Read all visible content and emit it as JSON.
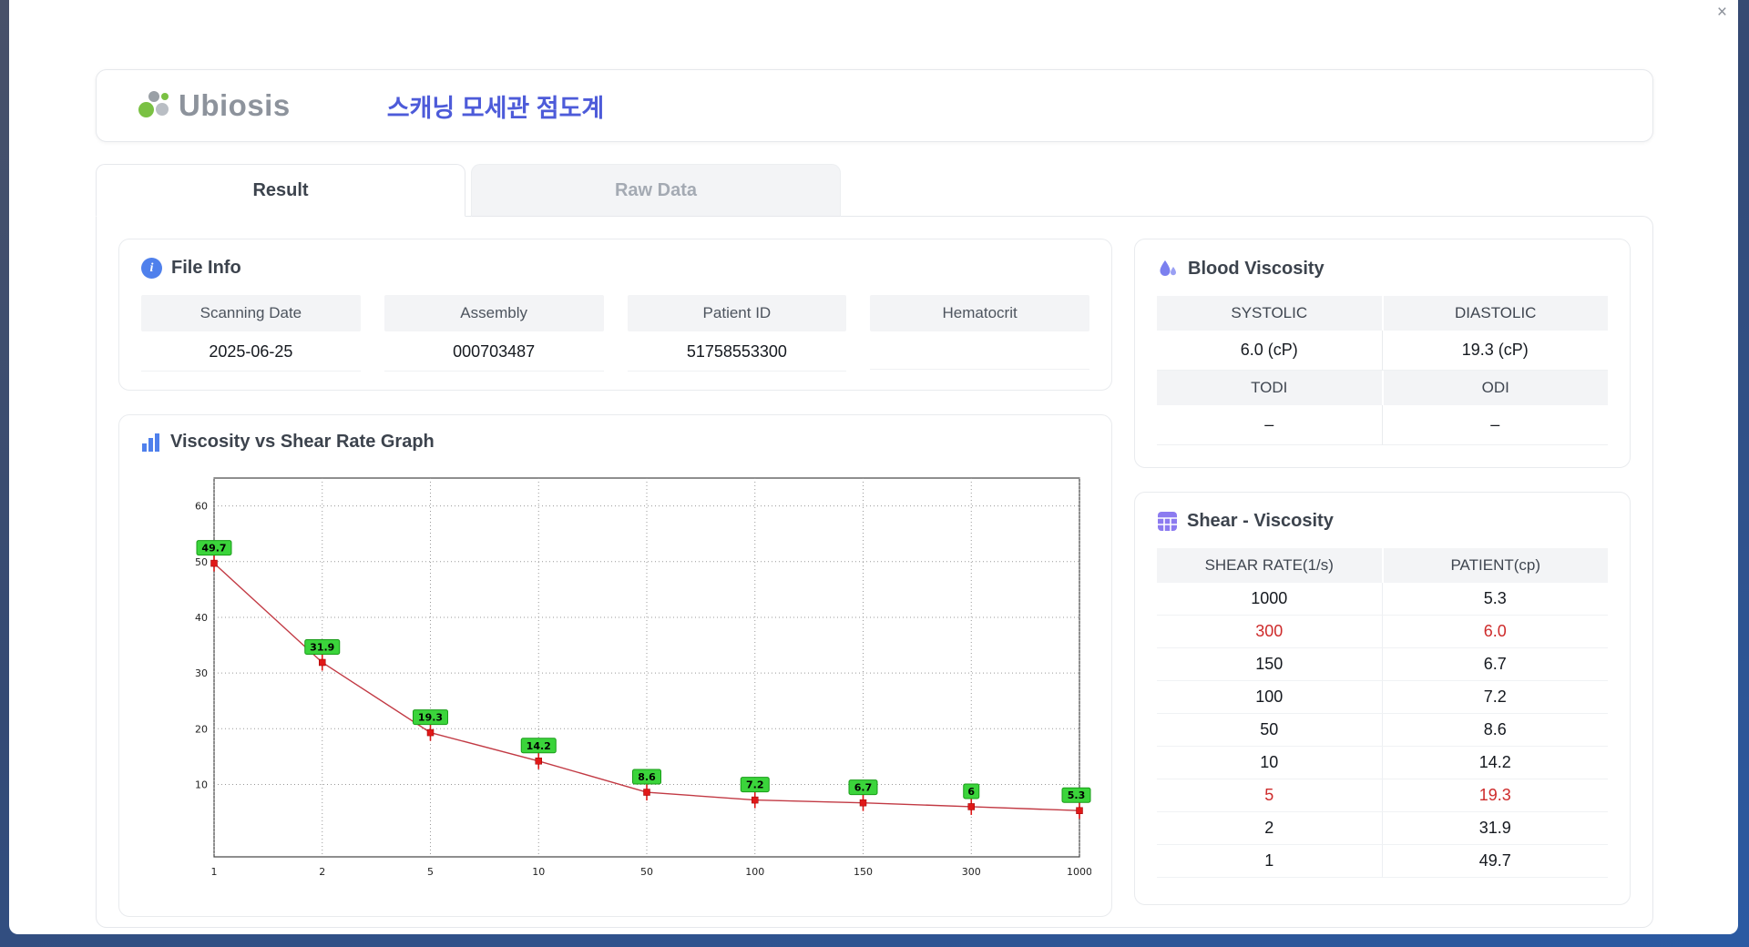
{
  "window": {
    "close": "×"
  },
  "header": {
    "logo": "Ubiosis",
    "title": "스캐닝 모세관 점도계"
  },
  "tabs": {
    "result": "Result",
    "raw_data": "Raw Data"
  },
  "file_info": {
    "title": "File Info",
    "fields": [
      {
        "label": "Scanning Date",
        "value": "2025-06-25"
      },
      {
        "label": "Assembly",
        "value": "000703487"
      },
      {
        "label": "Patient ID",
        "value": "51758553300"
      },
      {
        "label": "Hematocrit",
        "value": ""
      }
    ]
  },
  "graph": {
    "title": "Viscosity vs Shear Rate Graph"
  },
  "chart_data": {
    "type": "line",
    "title": "Viscosity vs Shear Rate Graph",
    "x": [
      1,
      2,
      5,
      10,
      50,
      100,
      150,
      300,
      1000
    ],
    "x_labels": [
      "1",
      "2",
      "5",
      "10",
      "50",
      "100",
      "150",
      "300",
      "1000"
    ],
    "values": [
      49.7,
      31.9,
      19.3,
      14.2,
      8.6,
      7.2,
      6.7,
      6,
      5.3
    ],
    "point_labels": [
      "49.7",
      "31.9",
      "19.3",
      "14.2",
      "8.6",
      "7.2",
      "6.7",
      "6",
      "5.3"
    ],
    "y_ticks": [
      10,
      20,
      30,
      40,
      50,
      60
    ],
    "ylim": [
      -3,
      65
    ],
    "x_scale": "even-categorical",
    "grid": "dotted",
    "xlabel": "",
    "ylabel": "",
    "line_color": "#c23a44",
    "marker_color": "#e01818",
    "label_bg": "#3bd43b",
    "label_border": "#189c18"
  },
  "blood_viscosity": {
    "title": "Blood Viscosity",
    "sections": [
      {
        "headers": [
          "SYSTOLIC",
          "DIASTOLIC"
        ],
        "values": [
          "6.0 (cP)",
          "19.3 (cP)"
        ]
      },
      {
        "headers": [
          "TODI",
          "ODI"
        ],
        "values": [
          "–",
          "–"
        ]
      }
    ]
  },
  "shear_table": {
    "title": "Shear - Viscosity",
    "columns": [
      "SHEAR RATE(1/s)",
      "PATIENT(cp)"
    ],
    "rows": [
      {
        "shear": "1000",
        "patient": "5.3",
        "highlight": false
      },
      {
        "shear": "300",
        "patient": "6.0",
        "highlight": true
      },
      {
        "shear": "150",
        "patient": "6.7",
        "highlight": false
      },
      {
        "shear": "100",
        "patient": "7.2",
        "highlight": false
      },
      {
        "shear": "50",
        "patient": "8.6",
        "highlight": false
      },
      {
        "shear": "10",
        "patient": "14.2",
        "highlight": false
      },
      {
        "shear": "5",
        "patient": "19.3",
        "highlight": true
      },
      {
        "shear": "2",
        "patient": "31.9",
        "highlight": false
      },
      {
        "shear": "1",
        "patient": "49.7",
        "highlight": false
      }
    ]
  }
}
